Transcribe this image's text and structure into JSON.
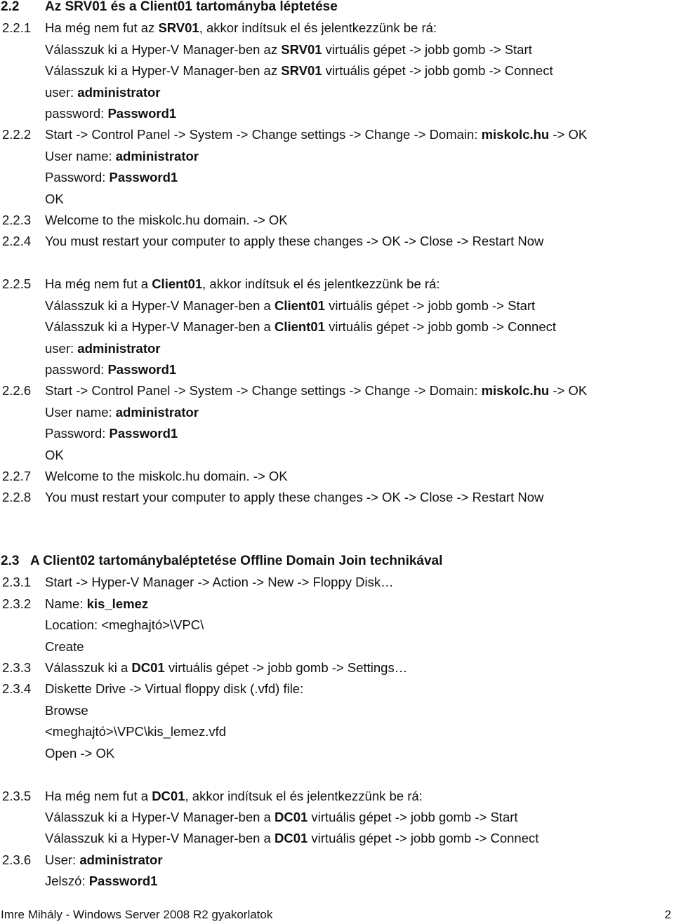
{
  "section_2_2": {
    "number": "2.2",
    "title": "Az SRV01 és a Client01 tartományba léptetése",
    "steps": [
      {
        "number": "2.2.1",
        "lines": [
          [
            {
              "t": "Ha még nem fut az "
            },
            {
              "t": "SRV01",
              "b": true
            },
            {
              "t": ", akkor indítsuk el és jelentkezzünk be rá:"
            }
          ],
          [
            {
              "t": "Válasszuk ki a Hyper-V Manager-ben az "
            },
            {
              "t": "SRV01",
              "b": true
            },
            {
              "t": " virtuális gépet -> jobb gomb -> Start"
            }
          ],
          [
            {
              "t": "Válasszuk ki a Hyper-V Manager-ben az "
            },
            {
              "t": "SRV01",
              "b": true
            },
            {
              "t": " virtuális gépet -> jobb gomb -> Connect"
            }
          ],
          [
            {
              "t": "user: "
            },
            {
              "t": "administrator",
              "b": true
            }
          ],
          [
            {
              "t": "password: "
            },
            {
              "t": "Password1",
              "b": true
            }
          ]
        ]
      },
      {
        "number": "2.2.2",
        "lines": [
          [
            {
              "t": "Start -> Control Panel -> System -> Change settings -> Change -> Domain: "
            },
            {
              "t": "miskolc.hu",
              "b": true
            },
            {
              "t": " -> OK"
            }
          ],
          [
            {
              "t": "User name: "
            },
            {
              "t": "administrator",
              "b": true
            }
          ],
          [
            {
              "t": "Password: "
            },
            {
              "t": "Password1",
              "b": true
            }
          ],
          [
            {
              "t": "OK"
            }
          ]
        ]
      },
      {
        "number": "2.2.3",
        "lines": [
          [
            {
              "t": "Welcome to the miskolc.hu domain. -> OK"
            }
          ]
        ]
      },
      {
        "number": "2.2.4",
        "lines": [
          [
            {
              "t": "You must restart your computer to apply these changes -> OK -> Close -> Restart Now"
            }
          ]
        ]
      },
      {
        "number": "2.2.5",
        "lines": [
          [
            {
              "t": "Ha még nem fut a "
            },
            {
              "t": "Client01",
              "b": true
            },
            {
              "t": ", akkor indítsuk el és jelentkezzünk be rá:"
            }
          ],
          [
            {
              "t": "Válasszuk ki a Hyper-V Manager-ben a "
            },
            {
              "t": "Client01",
              "b": true
            },
            {
              "t": " virtuális gépet -> jobb gomb -> Start"
            }
          ],
          [
            {
              "t": "Válasszuk ki a Hyper-V Manager-ben a "
            },
            {
              "t": "Client01",
              "b": true
            },
            {
              "t": " virtuális gépet -> jobb gomb -> Connect"
            }
          ],
          [
            {
              "t": "user: "
            },
            {
              "t": "administrator",
              "b": true
            }
          ],
          [
            {
              "t": "password: "
            },
            {
              "t": "Password1",
              "b": true
            }
          ]
        ]
      },
      {
        "number": "2.2.6",
        "lines": [
          [
            {
              "t": "Start -> Control Panel -> System -> Change settings -> Change -> Domain: "
            },
            {
              "t": "miskolc.hu",
              "b": true
            },
            {
              "t": " -> OK"
            }
          ],
          [
            {
              "t": "User name: "
            },
            {
              "t": "administrator",
              "b": true
            }
          ],
          [
            {
              "t": "Password: "
            },
            {
              "t": "Password1",
              "b": true
            }
          ],
          [
            {
              "t": "OK"
            }
          ]
        ]
      },
      {
        "number": "2.2.7",
        "lines": [
          [
            {
              "t": "Welcome to the miskolc.hu domain. -> OK"
            }
          ]
        ]
      },
      {
        "number": "2.2.8",
        "lines": [
          [
            {
              "t": "You must restart your computer to apply these changes -> OK -> Close -> Restart Now"
            }
          ]
        ]
      }
    ]
  },
  "section_2_3": {
    "number": "2.3",
    "title": "A Client02 tartománybaléptetése Offline Domain Join technikával",
    "steps": [
      {
        "number": "2.3.1",
        "lines": [
          [
            {
              "t": "Start -> Hyper-V Manager -> Action -> New -> Floppy Disk…"
            }
          ]
        ]
      },
      {
        "number": "2.3.2",
        "lines": [
          [
            {
              "t": "Name: "
            },
            {
              "t": "kis_lemez",
              "b": true
            }
          ],
          [
            {
              "t": "Location: <meghajtó>\\VPC\\"
            }
          ],
          [
            {
              "t": "Create"
            }
          ]
        ]
      },
      {
        "number": "2.3.3",
        "lines": [
          [
            {
              "t": "Válasszuk ki a "
            },
            {
              "t": "DC01",
              "b": true
            },
            {
              "t": " virtuális gépet -> jobb gomb -> Settings…"
            }
          ]
        ]
      },
      {
        "number": "2.3.4",
        "lines": [
          [
            {
              "t": "Diskette Drive -> Virtual floppy disk (.vfd) file:"
            }
          ],
          [
            {
              "t": "Browse"
            }
          ],
          [
            {
              "t": "<meghajtó>\\VPC\\kis_lemez.vfd"
            }
          ],
          [
            {
              "t": "Open -> OK"
            }
          ]
        ]
      },
      {
        "number": "2.3.5",
        "lines": [
          [
            {
              "t": "Ha még nem fut a "
            },
            {
              "t": "DC01",
              "b": true
            },
            {
              "t": ", akkor indítsuk el és jelentkezzünk be rá:"
            }
          ],
          [
            {
              "t": "Válasszuk ki a Hyper-V Manager-ben a "
            },
            {
              "t": "DC01",
              "b": true
            },
            {
              "t": " virtuális gépet -> jobb gomb -> Start"
            }
          ],
          [
            {
              "t": "Válasszuk ki a Hyper-V Manager-ben a "
            },
            {
              "t": "DC01",
              "b": true
            },
            {
              "t": " virtuális gépet -> jobb gomb -> Connect"
            }
          ]
        ]
      },
      {
        "number": "2.3.6",
        "lines": [
          [
            {
              "t": "User: "
            },
            {
              "t": "administrator",
              "b": true
            }
          ],
          [
            {
              "t": "Jelszó: "
            },
            {
              "t": "Password1",
              "b": true
            }
          ]
        ]
      }
    ]
  },
  "footer": {
    "text": "Imre Mihály - Windows Server 2008 R2 gyakorlatok",
    "page_number": "2"
  }
}
